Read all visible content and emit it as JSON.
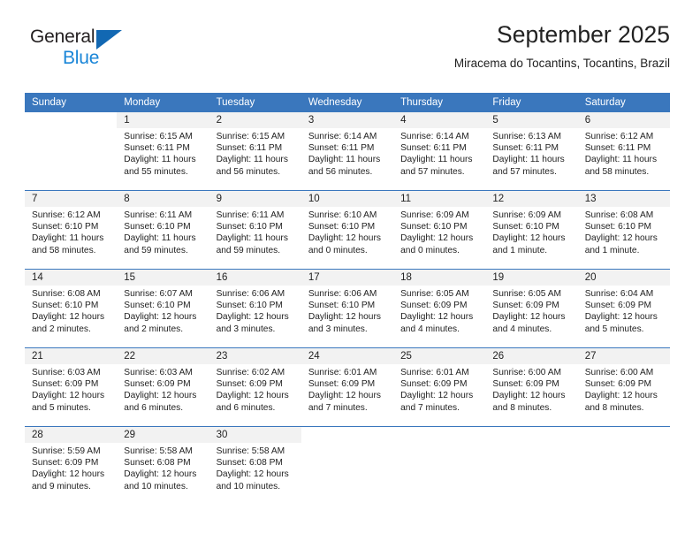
{
  "brand": {
    "name_part1": "General",
    "name_part2": "Blue",
    "triangle_color": "#1268b3",
    "blue_color": "#1a86d8"
  },
  "header": {
    "title": "September 2025",
    "subtitle": "Miracema do Tocantins, Tocantins, Brazil"
  },
  "theme": {
    "header_bg": "#3a77bd",
    "daynum_bg": "#f2f2f2",
    "row_divider": "#3a77bd",
    "text": "#222222"
  },
  "calendar": {
    "weekday_headers": [
      "Sunday",
      "Monday",
      "Tuesday",
      "Wednesday",
      "Thursday",
      "Friday",
      "Saturday"
    ],
    "weeks": [
      [
        {
          "day": "",
          "sunrise": "",
          "sunset": "",
          "daylight_line1": "",
          "daylight_line2": "",
          "blank": true
        },
        {
          "day": "1",
          "sunrise": "Sunrise: 6:15 AM",
          "sunset": "Sunset: 6:11 PM",
          "daylight_line1": "Daylight: 11 hours",
          "daylight_line2": "and 55 minutes."
        },
        {
          "day": "2",
          "sunrise": "Sunrise: 6:15 AM",
          "sunset": "Sunset: 6:11 PM",
          "daylight_line1": "Daylight: 11 hours",
          "daylight_line2": "and 56 minutes."
        },
        {
          "day": "3",
          "sunrise": "Sunrise: 6:14 AM",
          "sunset": "Sunset: 6:11 PM",
          "daylight_line1": "Daylight: 11 hours",
          "daylight_line2": "and 56 minutes."
        },
        {
          "day": "4",
          "sunrise": "Sunrise: 6:14 AM",
          "sunset": "Sunset: 6:11 PM",
          "daylight_line1": "Daylight: 11 hours",
          "daylight_line2": "and 57 minutes."
        },
        {
          "day": "5",
          "sunrise": "Sunrise: 6:13 AM",
          "sunset": "Sunset: 6:11 PM",
          "daylight_line1": "Daylight: 11 hours",
          "daylight_line2": "and 57 minutes."
        },
        {
          "day": "6",
          "sunrise": "Sunrise: 6:12 AM",
          "sunset": "Sunset: 6:11 PM",
          "daylight_line1": "Daylight: 11 hours",
          "daylight_line2": "and 58 minutes."
        }
      ],
      [
        {
          "day": "7",
          "sunrise": "Sunrise: 6:12 AM",
          "sunset": "Sunset: 6:10 PM",
          "daylight_line1": "Daylight: 11 hours",
          "daylight_line2": "and 58 minutes."
        },
        {
          "day": "8",
          "sunrise": "Sunrise: 6:11 AM",
          "sunset": "Sunset: 6:10 PM",
          "daylight_line1": "Daylight: 11 hours",
          "daylight_line2": "and 59 minutes."
        },
        {
          "day": "9",
          "sunrise": "Sunrise: 6:11 AM",
          "sunset": "Sunset: 6:10 PM",
          "daylight_line1": "Daylight: 11 hours",
          "daylight_line2": "and 59 minutes."
        },
        {
          "day": "10",
          "sunrise": "Sunrise: 6:10 AM",
          "sunset": "Sunset: 6:10 PM",
          "daylight_line1": "Daylight: 12 hours",
          "daylight_line2": "and 0 minutes."
        },
        {
          "day": "11",
          "sunrise": "Sunrise: 6:09 AM",
          "sunset": "Sunset: 6:10 PM",
          "daylight_line1": "Daylight: 12 hours",
          "daylight_line2": "and 0 minutes."
        },
        {
          "day": "12",
          "sunrise": "Sunrise: 6:09 AM",
          "sunset": "Sunset: 6:10 PM",
          "daylight_line1": "Daylight: 12 hours",
          "daylight_line2": "and 1 minute."
        },
        {
          "day": "13",
          "sunrise": "Sunrise: 6:08 AM",
          "sunset": "Sunset: 6:10 PM",
          "daylight_line1": "Daylight: 12 hours",
          "daylight_line2": "and 1 minute."
        }
      ],
      [
        {
          "day": "14",
          "sunrise": "Sunrise: 6:08 AM",
          "sunset": "Sunset: 6:10 PM",
          "daylight_line1": "Daylight: 12 hours",
          "daylight_line2": "and 2 minutes."
        },
        {
          "day": "15",
          "sunrise": "Sunrise: 6:07 AM",
          "sunset": "Sunset: 6:10 PM",
          "daylight_line1": "Daylight: 12 hours",
          "daylight_line2": "and 2 minutes."
        },
        {
          "day": "16",
          "sunrise": "Sunrise: 6:06 AM",
          "sunset": "Sunset: 6:10 PM",
          "daylight_line1": "Daylight: 12 hours",
          "daylight_line2": "and 3 minutes."
        },
        {
          "day": "17",
          "sunrise": "Sunrise: 6:06 AM",
          "sunset": "Sunset: 6:10 PM",
          "daylight_line1": "Daylight: 12 hours",
          "daylight_line2": "and 3 minutes."
        },
        {
          "day": "18",
          "sunrise": "Sunrise: 6:05 AM",
          "sunset": "Sunset: 6:09 PM",
          "daylight_line1": "Daylight: 12 hours",
          "daylight_line2": "and 4 minutes."
        },
        {
          "day": "19",
          "sunrise": "Sunrise: 6:05 AM",
          "sunset": "Sunset: 6:09 PM",
          "daylight_line1": "Daylight: 12 hours",
          "daylight_line2": "and 4 minutes."
        },
        {
          "day": "20",
          "sunrise": "Sunrise: 6:04 AM",
          "sunset": "Sunset: 6:09 PM",
          "daylight_line1": "Daylight: 12 hours",
          "daylight_line2": "and 5 minutes."
        }
      ],
      [
        {
          "day": "21",
          "sunrise": "Sunrise: 6:03 AM",
          "sunset": "Sunset: 6:09 PM",
          "daylight_line1": "Daylight: 12 hours",
          "daylight_line2": "and 5 minutes."
        },
        {
          "day": "22",
          "sunrise": "Sunrise: 6:03 AM",
          "sunset": "Sunset: 6:09 PM",
          "daylight_line1": "Daylight: 12 hours",
          "daylight_line2": "and 6 minutes."
        },
        {
          "day": "23",
          "sunrise": "Sunrise: 6:02 AM",
          "sunset": "Sunset: 6:09 PM",
          "daylight_line1": "Daylight: 12 hours",
          "daylight_line2": "and 6 minutes."
        },
        {
          "day": "24",
          "sunrise": "Sunrise: 6:01 AM",
          "sunset": "Sunset: 6:09 PM",
          "daylight_line1": "Daylight: 12 hours",
          "daylight_line2": "and 7 minutes."
        },
        {
          "day": "25",
          "sunrise": "Sunrise: 6:01 AM",
          "sunset": "Sunset: 6:09 PM",
          "daylight_line1": "Daylight: 12 hours",
          "daylight_line2": "and 7 minutes."
        },
        {
          "day": "26",
          "sunrise": "Sunrise: 6:00 AM",
          "sunset": "Sunset: 6:09 PM",
          "daylight_line1": "Daylight: 12 hours",
          "daylight_line2": "and 8 minutes."
        },
        {
          "day": "27",
          "sunrise": "Sunrise: 6:00 AM",
          "sunset": "Sunset: 6:09 PM",
          "daylight_line1": "Daylight: 12 hours",
          "daylight_line2": "and 8 minutes."
        }
      ],
      [
        {
          "day": "28",
          "sunrise": "Sunrise: 5:59 AM",
          "sunset": "Sunset: 6:09 PM",
          "daylight_line1": "Daylight: 12 hours",
          "daylight_line2": "and 9 minutes."
        },
        {
          "day": "29",
          "sunrise": "Sunrise: 5:58 AM",
          "sunset": "Sunset: 6:08 PM",
          "daylight_line1": "Daylight: 12 hours",
          "daylight_line2": "and 10 minutes."
        },
        {
          "day": "30",
          "sunrise": "Sunrise: 5:58 AM",
          "sunset": "Sunset: 6:08 PM",
          "daylight_line1": "Daylight: 12 hours",
          "daylight_line2": "and 10 minutes."
        },
        {
          "day": "",
          "sunrise": "",
          "sunset": "",
          "daylight_line1": "",
          "daylight_line2": "",
          "blank": true
        },
        {
          "day": "",
          "sunrise": "",
          "sunset": "",
          "daylight_line1": "",
          "daylight_line2": "",
          "blank": true
        },
        {
          "day": "",
          "sunrise": "",
          "sunset": "",
          "daylight_line1": "",
          "daylight_line2": "",
          "blank": true
        },
        {
          "day": "",
          "sunrise": "",
          "sunset": "",
          "daylight_line1": "",
          "daylight_line2": "",
          "blank": true
        }
      ]
    ]
  }
}
